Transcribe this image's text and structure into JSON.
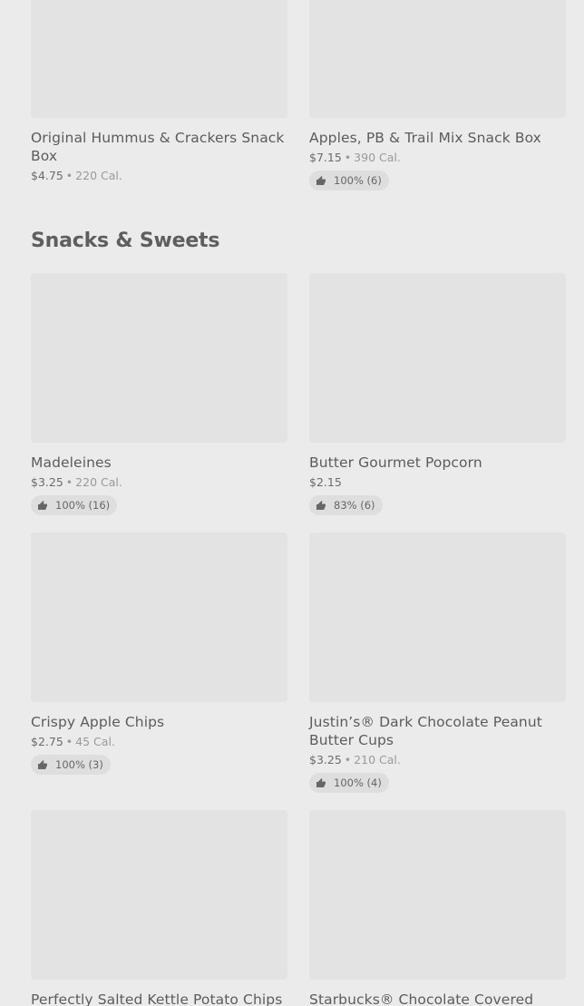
{
  "section": {
    "title": "Snacks & Sweets"
  },
  "top_row": [
    {
      "name": "Original Hummus & Crackers Snack Box",
      "price": "$4.75",
      "calories": "220 Cal.",
      "rating": ""
    },
    {
      "name": "Apples, PB & Trail Mix Snack Box",
      "price": "$7.15",
      "calories": "390 Cal.",
      "rating": "100% (6)"
    }
  ],
  "items": [
    {
      "name": "Madeleines",
      "price": "$3.25",
      "calories": "220 Cal.",
      "rating": "100% (16)"
    },
    {
      "name": "Butter Gourmet Popcorn",
      "price": "$2.15",
      "calories": "",
      "rating": "83% (6)"
    },
    {
      "name": "Crispy Apple Chips",
      "price": "$2.75",
      "calories": "45 Cal.",
      "rating": "100% (3)"
    },
    {
      "name": "Justin’s® Dark Chocolate Peanut Butter Cups",
      "price": "$3.25",
      "calories": "210 Cal.",
      "rating": "100% (4)"
    },
    {
      "name": "Perfectly Salted Kettle Potato Chips",
      "price": "",
      "calories": "",
      "rating": ""
    },
    {
      "name": "Starbucks® Chocolate Covered Espresso Beans",
      "price": "",
      "calories": "",
      "rating": ""
    }
  ],
  "icons": {
    "rating": "thumbs-up-icon"
  },
  "colors": {
    "background": "#ebebeb",
    "image_placeholder": "#e3e3e3",
    "rating_pill": "#dedede"
  }
}
